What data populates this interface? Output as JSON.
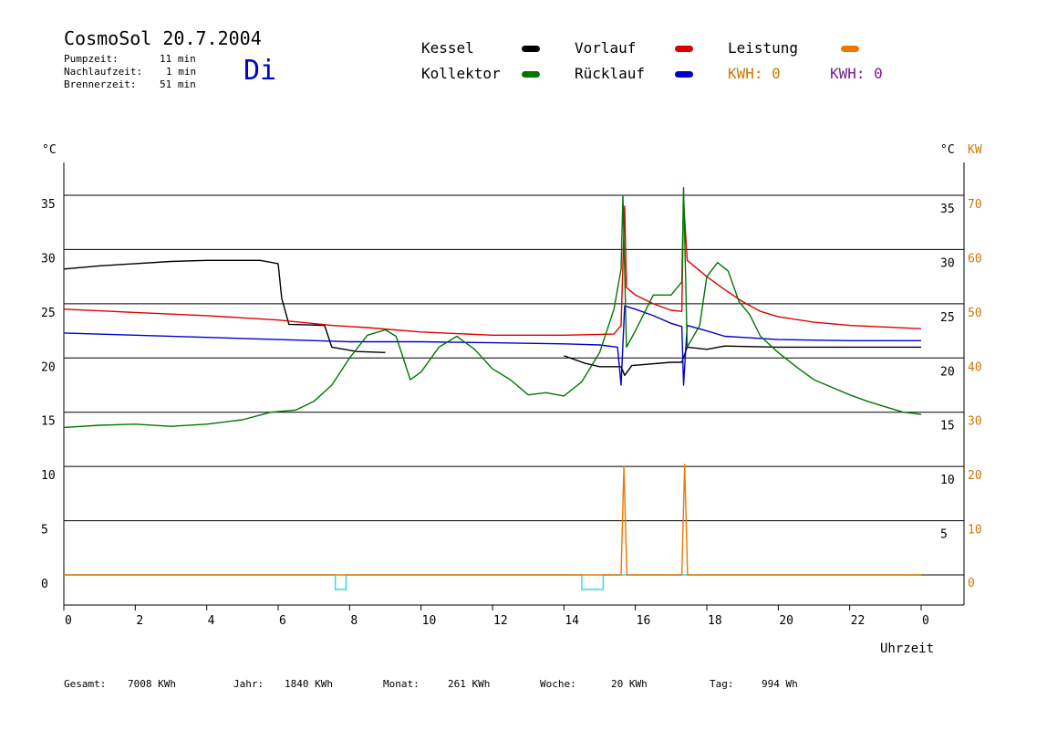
{
  "header": {
    "title": "CosmoSol 20.7.2004",
    "day": "Di",
    "stats": [
      {
        "label": "Pumpzeit:",
        "value": "11 min"
      },
      {
        "label": "Nachlaufzeit:",
        "value": "1 min"
      },
      {
        "label": "Brennerzeit:",
        "value": "51 min"
      }
    ]
  },
  "legend": [
    {
      "name": "Kessel",
      "color": "#000000"
    },
    {
      "name": "Kollektor",
      "color": "#007700"
    },
    {
      "name": "Vorlauf",
      "color": "#dd0000"
    },
    {
      "name": "Rücklauf",
      "color": "#0000cc"
    },
    {
      "name": "Leistung",
      "color": "#ee7700"
    }
  ],
  "kwh": [
    {
      "label": "KWH: 0",
      "color": "#cc7700"
    },
    {
      "label": "KWH: 0",
      "color": "#7a1a99"
    }
  ],
  "footer": [
    {
      "label": "Gesamt:",
      "value": "7008 KWh"
    },
    {
      "label": "Jahr:",
      "value": "1840 KWh"
    },
    {
      "label": "Monat:",
      "value": "261 KWh"
    },
    {
      "label": "Woche:",
      "value": "20 KWh"
    },
    {
      "label": "Tag:",
      "value": "994 Wh"
    }
  ],
  "chart_data": {
    "type": "line",
    "xlabel": "Uhrzeit",
    "xticks": [
      "0",
      "2",
      "4",
      "6",
      "8",
      "10",
      "12",
      "14",
      "16",
      "18",
      "20",
      "22",
      "0"
    ],
    "xlim": [
      0,
      24
    ],
    "ylabel_left": "°C",
    "ylabel_right_c": "°C",
    "ylabel_right_kw": "KW",
    "ylim": [
      0,
      35
    ],
    "yticks_c": [
      "0",
      "5",
      "10",
      "15",
      "20",
      "25",
      "30",
      "35"
    ],
    "yticks_kw": [
      "0",
      "10",
      "20",
      "30",
      "40",
      "50",
      "60",
      "70"
    ],
    "grid": true,
    "series": [
      {
        "name": "Kessel",
        "color": "#000000",
        "points": [
          [
            0,
            28.2
          ],
          [
            1,
            28.5
          ],
          [
            2,
            28.7
          ],
          [
            3,
            28.9
          ],
          [
            4,
            29.0
          ],
          [
            5.5,
            29.0
          ],
          [
            6.0,
            28.7
          ],
          [
            6.1,
            25.5
          ],
          [
            6.3,
            23.1
          ],
          [
            7.3,
            23.0
          ],
          [
            7.5,
            21.0
          ],
          [
            8.2,
            20.6
          ],
          [
            9.0,
            20.5
          ],
          [
            9.01,
            null
          ],
          [
            14.0,
            20.2
          ],
          [
            14.6,
            19.5
          ],
          [
            15.0,
            19.2
          ],
          [
            15.6,
            19.2
          ],
          [
            15.7,
            18.4
          ],
          [
            15.9,
            19.3
          ],
          [
            17.0,
            19.6
          ],
          [
            17.3,
            19.6
          ],
          [
            17.45,
            21.0
          ],
          [
            18.0,
            20.8
          ],
          [
            18.5,
            21.1
          ],
          [
            20,
            21.0
          ],
          [
            22,
            21.0
          ],
          [
            24,
            21.0
          ]
        ]
      },
      {
        "name": "Vorlauf",
        "color": "#dd0000",
        "points": [
          [
            0,
            24.5
          ],
          [
            2,
            24.2
          ],
          [
            4,
            23.9
          ],
          [
            6,
            23.5
          ],
          [
            7.5,
            23.0
          ],
          [
            8.5,
            22.8
          ],
          [
            10,
            22.4
          ],
          [
            12,
            22.1
          ],
          [
            14,
            22.1
          ],
          [
            15.4,
            22.2
          ],
          [
            15.6,
            23.0
          ],
          [
            15.7,
            34.0
          ],
          [
            15.75,
            26.5
          ],
          [
            16,
            25.8
          ],
          [
            16.5,
            25.0
          ],
          [
            17.0,
            24.4
          ],
          [
            17.3,
            24.3
          ],
          [
            17.35,
            34.5
          ],
          [
            17.45,
            29.0
          ],
          [
            18,
            27.5
          ],
          [
            18.5,
            26.3
          ],
          [
            19,
            25.2
          ],
          [
            19.5,
            24.3
          ],
          [
            20,
            23.8
          ],
          [
            21,
            23.3
          ],
          [
            22,
            23.0
          ],
          [
            24,
            22.7
          ]
        ]
      },
      {
        "name": "Rücklauf",
        "color": "#0000cc",
        "points": [
          [
            0,
            22.3
          ],
          [
            2,
            22.1
          ],
          [
            4,
            21.9
          ],
          [
            6,
            21.7
          ],
          [
            8,
            21.5
          ],
          [
            10,
            21.5
          ],
          [
            12,
            21.4
          ],
          [
            14,
            21.3
          ],
          [
            15.0,
            21.2
          ],
          [
            15.5,
            21.0
          ],
          [
            15.6,
            17.5
          ],
          [
            15.7,
            24.8
          ],
          [
            16,
            24.5
          ],
          [
            16.5,
            23.9
          ],
          [
            17.0,
            23.2
          ],
          [
            17.3,
            22.9
          ],
          [
            17.35,
            17.5
          ],
          [
            17.45,
            23.0
          ],
          [
            18,
            22.5
          ],
          [
            18.5,
            22.0
          ],
          [
            19,
            21.9
          ],
          [
            20,
            21.7
          ],
          [
            22,
            21.6
          ],
          [
            24,
            21.6
          ]
        ]
      },
      {
        "name": "Kollektor",
        "color": "#007700",
        "points": [
          [
            0,
            13.6
          ],
          [
            1,
            13.8
          ],
          [
            2,
            13.9
          ],
          [
            3,
            13.7
          ],
          [
            4,
            13.9
          ],
          [
            5,
            14.3
          ],
          [
            5.8,
            15.0
          ],
          [
            6.5,
            15.2
          ],
          [
            7,
            16.0
          ],
          [
            7.5,
            17.5
          ],
          [
            8,
            20.0
          ],
          [
            8.5,
            22.1
          ],
          [
            9,
            22.6
          ],
          [
            9.3,
            22.0
          ],
          [
            9.7,
            18.0
          ],
          [
            10,
            18.7
          ],
          [
            10.5,
            21.0
          ],
          [
            11,
            22.0
          ],
          [
            11.5,
            20.8
          ],
          [
            12,
            19.0
          ],
          [
            12.5,
            18.0
          ],
          [
            13,
            16.6
          ],
          [
            13.5,
            16.8
          ],
          [
            14,
            16.5
          ],
          [
            14.5,
            17.8
          ],
          [
            15,
            20.5
          ],
          [
            15.4,
            24.5
          ],
          [
            15.6,
            28.2
          ],
          [
            15.65,
            35.0
          ],
          [
            15.75,
            21.0
          ],
          [
            16,
            22.5
          ],
          [
            16.5,
            25.8
          ],
          [
            17,
            25.8
          ],
          [
            17.3,
            27.0
          ],
          [
            17.35,
            35.7
          ],
          [
            17.45,
            21.0
          ],
          [
            17.8,
            23.0
          ],
          [
            18,
            27.5
          ],
          [
            18.3,
            28.8
          ],
          [
            18.6,
            28.0
          ],
          [
            18.9,
            25.2
          ],
          [
            19.2,
            24.0
          ],
          [
            19.5,
            22.0
          ],
          [
            20,
            20.5
          ],
          [
            20.5,
            19.2
          ],
          [
            21,
            18.0
          ],
          [
            21.5,
            17.3
          ],
          [
            22,
            16.6
          ],
          [
            22.5,
            16.0
          ],
          [
            23,
            15.5
          ],
          [
            23.5,
            15.0
          ],
          [
            24,
            14.8
          ]
        ]
      },
      {
        "name": "Leistung",
        "color": "#ee7700",
        "points": [
          [
            0,
            0
          ],
          [
            15.6,
            0
          ],
          [
            15.68,
            10.0
          ],
          [
            15.76,
            0
          ],
          [
            17.3,
            0
          ],
          [
            17.38,
            10.2
          ],
          [
            17.46,
            0
          ],
          [
            24,
            0
          ]
        ]
      }
    ],
    "pump_pulses": [
      [
        7.6,
        7.9
      ],
      [
        14.5,
        15.1
      ]
    ]
  }
}
